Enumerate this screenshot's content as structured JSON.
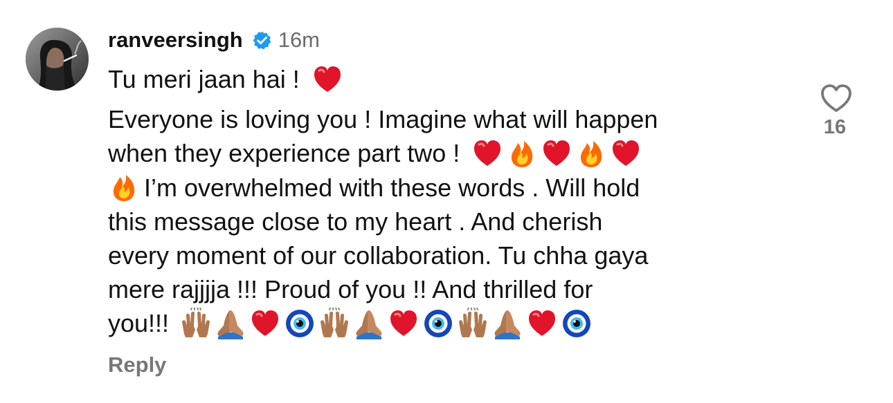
{
  "comment": {
    "username": "ranveersingh",
    "verified_icon": "verified-badge-icon",
    "timestamp": "16m",
    "first_line": "Tu meri jaan hai !",
    "body_lines": [
      "Everyone is loving you ! Imagine what will happen",
      "when they experience part two !",
      " I’m overwhelmed with these words . Will hold",
      "this message close to my heart . And cherish",
      "every moment of our collaboration. Tu chha gaya",
      "mere rajjjja !!! Proud of you !! And thrilled for",
      "you!!!"
    ],
    "emoji_names": [
      "red-heart-icon",
      "fire-icon",
      "raising-hands-icon",
      "folded-hands-icon",
      "evil-eye-icon"
    ],
    "like_count": "16",
    "reply_label": "Reply"
  },
  "colors": {
    "text": "#111111",
    "secondary": "#777777",
    "verified": "#1d9bf0",
    "heart": "#e0142a"
  }
}
